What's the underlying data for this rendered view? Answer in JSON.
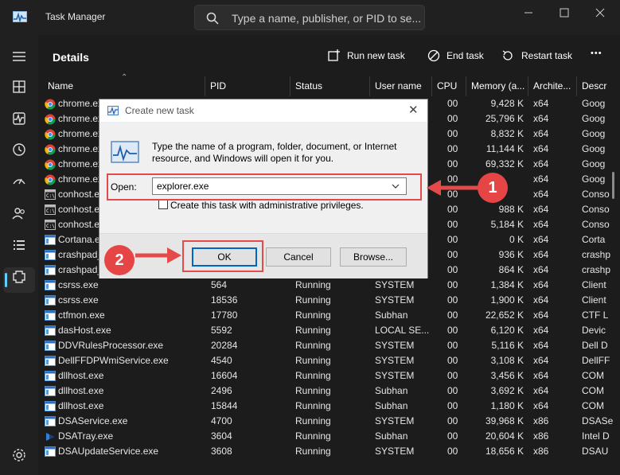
{
  "window": {
    "title": "Task Manager",
    "search_placeholder": "Type a name, publisher, or PID to se..."
  },
  "header": {
    "title": "Details",
    "run_new_task": "Run new task",
    "end_task": "End task",
    "restart_task": "Restart task",
    "more": "•••"
  },
  "sidebar": {
    "items": [
      "hamburger-icon",
      "processes-icon",
      "performance-icon",
      "app-history-icon",
      "startup-apps-icon",
      "users-icon",
      "details-icon",
      "services-icon",
      "settings-icon"
    ]
  },
  "table": {
    "columns": [
      "Name",
      "PID",
      "Status",
      "User name",
      "CPU",
      "Memory (a...",
      "Archite...",
      "Descr"
    ],
    "rows": [
      {
        "icon": "chrome",
        "name": "chrome.exe",
        "pid": "",
        "status": "",
        "user": "",
        "cpu": "00",
        "mem": "9,428 K",
        "arch": "x64",
        "desc": "Goog"
      },
      {
        "icon": "chrome",
        "name": "chrome.exe",
        "pid": "",
        "status": "",
        "user": "",
        "cpu": "00",
        "mem": "25,796 K",
        "arch": "x64",
        "desc": "Goog"
      },
      {
        "icon": "chrome",
        "name": "chrome.exe",
        "pid": "",
        "status": "",
        "user": "",
        "cpu": "00",
        "mem": "8,832 K",
        "arch": "x64",
        "desc": "Goog"
      },
      {
        "icon": "chrome",
        "name": "chrome.exe",
        "pid": "",
        "status": "",
        "user": "",
        "cpu": "00",
        "mem": "11,144 K",
        "arch": "x64",
        "desc": "Goog"
      },
      {
        "icon": "chrome",
        "name": "chrome.exe",
        "pid": "",
        "status": "",
        "user": "",
        "cpu": "00",
        "mem": "69,332 K",
        "arch": "x64",
        "desc": "Goog"
      },
      {
        "icon": "chrome",
        "name": "chrome.exe",
        "pid": "",
        "status": "",
        "user": "",
        "cpu": "00",
        "mem": "",
        "arch": "x64",
        "desc": "Goog"
      },
      {
        "icon": "console",
        "name": "conhost.exe",
        "pid": "",
        "status": "",
        "user": "",
        "cpu": "00",
        "mem": "",
        "arch": "x64",
        "desc": "Conso"
      },
      {
        "icon": "console",
        "name": "conhost.exe",
        "pid": "",
        "status": "",
        "user": "",
        "cpu": "00",
        "mem": "988 K",
        "arch": "x64",
        "desc": "Conso"
      },
      {
        "icon": "console",
        "name": "conhost.exe",
        "pid": "",
        "status": "",
        "user": "",
        "cpu": "00",
        "mem": "5,184 K",
        "arch": "x64",
        "desc": "Conso"
      },
      {
        "icon": "app",
        "name": "Cortana.exe",
        "pid": "",
        "status": "",
        "user": "",
        "cpu": "00",
        "mem": "0 K",
        "arch": "x64",
        "desc": "Corta"
      },
      {
        "icon": "app",
        "name": "crashpad_",
        "pid": "",
        "status": "",
        "user": "",
        "cpu": "00",
        "mem": "936 K",
        "arch": "x64",
        "desc": "crashp"
      },
      {
        "icon": "app",
        "name": "crashpad_",
        "pid": "",
        "status": "",
        "user": "",
        "cpu": "00",
        "mem": "864 K",
        "arch": "x64",
        "desc": "crashp"
      },
      {
        "icon": "app",
        "name": "csrss.exe",
        "pid": "564",
        "status": "Running",
        "user": "SYSTEM",
        "cpu": "00",
        "mem": "1,384 K",
        "arch": "x64",
        "desc": "Client"
      },
      {
        "icon": "app",
        "name": "csrss.exe",
        "pid": "18536",
        "status": "Running",
        "user": "SYSTEM",
        "cpu": "00",
        "mem": "1,900 K",
        "arch": "x64",
        "desc": "Client"
      },
      {
        "icon": "app",
        "name": "ctfmon.exe",
        "pid": "17780",
        "status": "Running",
        "user": "Subhan",
        "cpu": "00",
        "mem": "22,652 K",
        "arch": "x64",
        "desc": "CTF L"
      },
      {
        "icon": "app",
        "name": "dasHost.exe",
        "pid": "5592",
        "status": "Running",
        "user": "LOCAL SE...",
        "cpu": "00",
        "mem": "6,120 K",
        "arch": "x64",
        "desc": "Devic"
      },
      {
        "icon": "app",
        "name": "DDVRulesProcessor.exe",
        "pid": "20284",
        "status": "Running",
        "user": "SYSTEM",
        "cpu": "00",
        "mem": "5,116 K",
        "arch": "x64",
        "desc": "Dell D"
      },
      {
        "icon": "app",
        "name": "DellFFDPWmiService.exe",
        "pid": "4540",
        "status": "Running",
        "user": "SYSTEM",
        "cpu": "00",
        "mem": "3,108 K",
        "arch": "x64",
        "desc": "DellFF"
      },
      {
        "icon": "app",
        "name": "dllhost.exe",
        "pid": "16604",
        "status": "Running",
        "user": "SYSTEM",
        "cpu": "00",
        "mem": "3,456 K",
        "arch": "x64",
        "desc": "COM"
      },
      {
        "icon": "app",
        "name": "dllhost.exe",
        "pid": "2496",
        "status": "Running",
        "user": "Subhan",
        "cpu": "00",
        "mem": "3,692 K",
        "arch": "x64",
        "desc": "COM"
      },
      {
        "icon": "app",
        "name": "dllhost.exe",
        "pid": "15844",
        "status": "Running",
        "user": "Subhan",
        "cpu": "00",
        "mem": "1,180 K",
        "arch": "x64",
        "desc": "COM"
      },
      {
        "icon": "app",
        "name": "DSAService.exe",
        "pid": "4700",
        "status": "Running",
        "user": "SYSTEM",
        "cpu": "00",
        "mem": "39,968 K",
        "arch": "x86",
        "desc": "DSASe"
      },
      {
        "icon": "tray",
        "name": "DSATray.exe",
        "pid": "3604",
        "status": "Running",
        "user": "Subhan",
        "cpu": "00",
        "mem": "20,604 K",
        "arch": "x86",
        "desc": "Intel D"
      },
      {
        "icon": "app",
        "name": "DSAUpdateService.exe",
        "pid": "3608",
        "status": "Running",
        "user": "SYSTEM",
        "cpu": "00",
        "mem": "18,656 K",
        "arch": "x86",
        "desc": "DSAU"
      }
    ]
  },
  "dialog": {
    "title": "Create new task",
    "close": "✕",
    "description": "Type the name of a program, folder, document, or Internet resource, and Windows will open it for you.",
    "open_label": "Open:",
    "open_value": "explorer.exe",
    "admin_label": "Create this task with administrative privileges.",
    "ok": "OK",
    "cancel": "Cancel",
    "browse": "Browse..."
  },
  "annotations": {
    "step1": "1",
    "step2": "2",
    "color": "#e34b4b"
  }
}
